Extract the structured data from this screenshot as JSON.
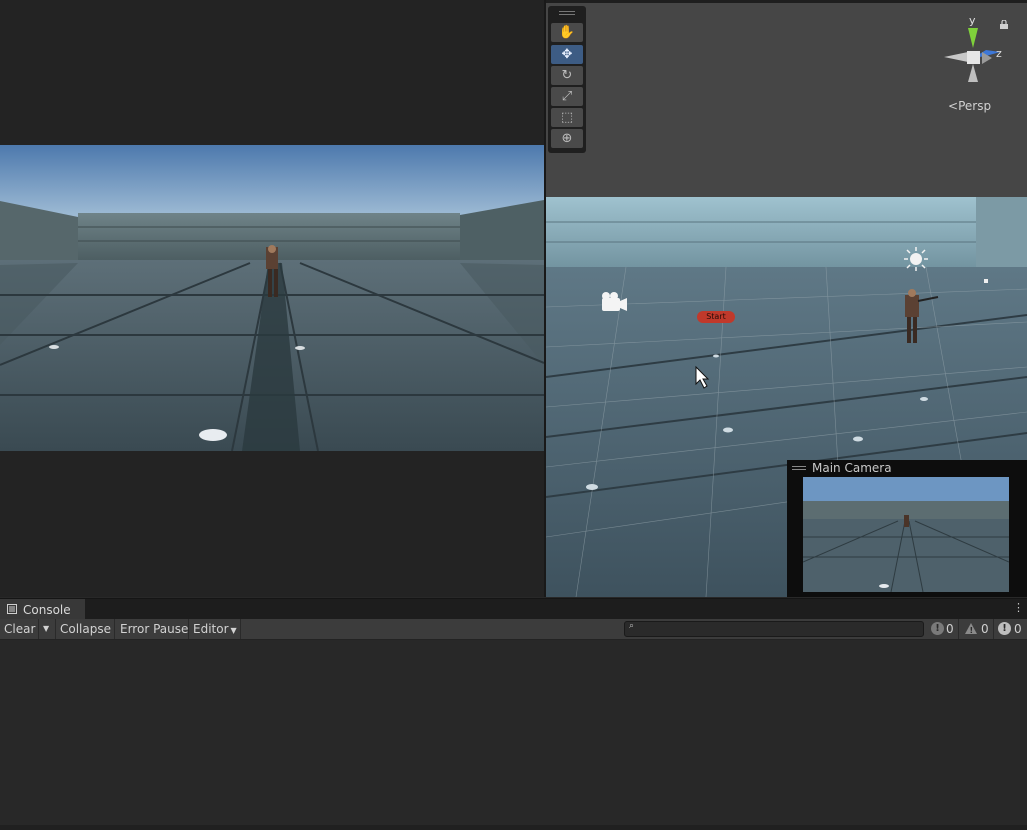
{
  "scene": {
    "persp_label": "Persp",
    "axis_y": "y",
    "axis_z": "z",
    "start_label": "Start",
    "camera_preview_title": "Main Camera",
    "tools": [
      {
        "name": "hand-tool",
        "icon": "hand-icon",
        "active": false
      },
      {
        "name": "move-tool",
        "icon": "move-icon",
        "active": true
      },
      {
        "name": "rotate-tool",
        "icon": "rotate-icon",
        "active": false
      },
      {
        "name": "scale-tool",
        "icon": "scale-icon",
        "active": false
      },
      {
        "name": "rect-tool",
        "icon": "rect-icon",
        "active": false
      },
      {
        "name": "transform-tool",
        "icon": "transform-icon",
        "active": false
      }
    ]
  },
  "console": {
    "tab_label": "Console",
    "clear_label": "Clear",
    "collapse_label": "Collapse",
    "error_pause_label": "Error Pause",
    "editor_label": "Editor",
    "search_placeholder": "",
    "log_count": "0",
    "warning_count": "0",
    "error_count": "0"
  },
  "colors": {
    "active_tool": "#3d5c84",
    "start_button": "#c0392b",
    "axis_y": "#7fd13b",
    "axis_z": "#3e78d8"
  }
}
